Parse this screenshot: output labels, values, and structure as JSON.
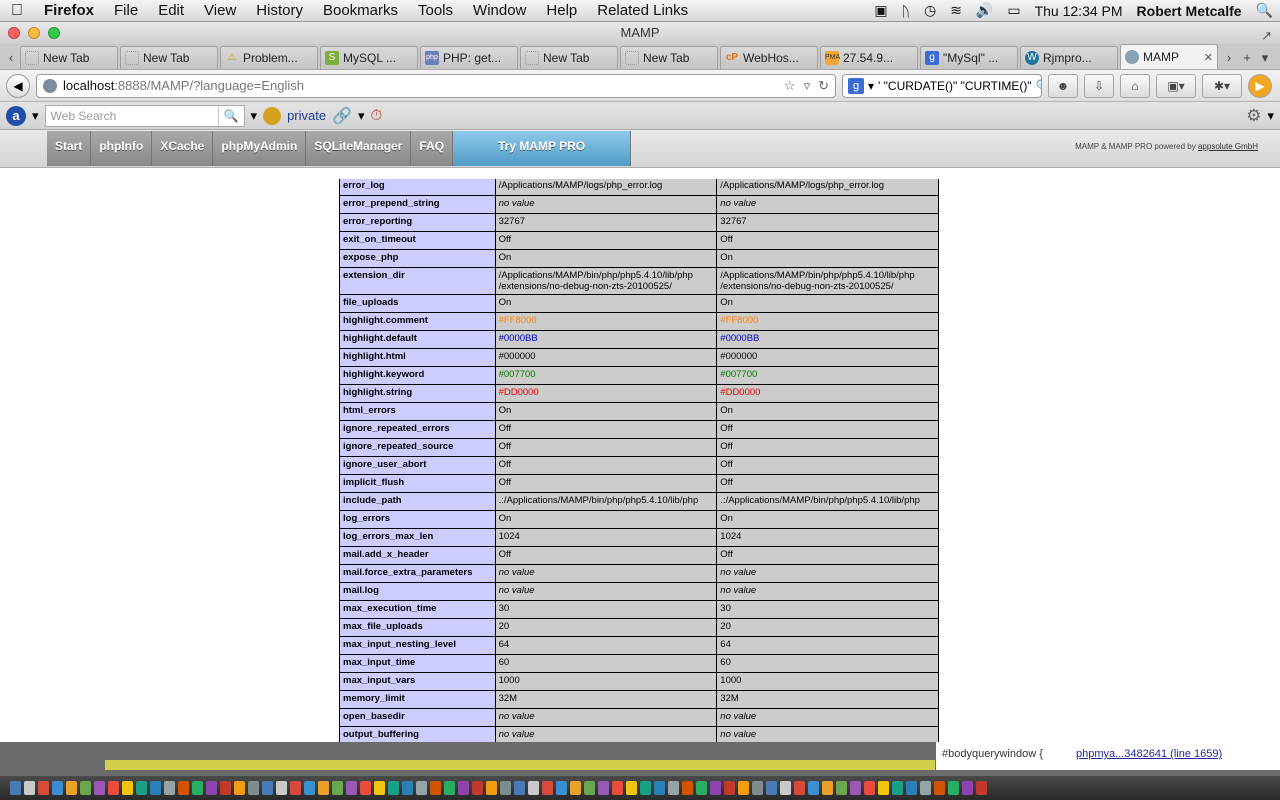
{
  "menubar": {
    "apple": "",
    "app": "Firefox",
    "items": [
      "File",
      "Edit",
      "View",
      "History",
      "Bookmarks",
      "Tools",
      "Window",
      "Help",
      "Related Links"
    ],
    "clock": "Thu 12:34 PM",
    "user": "Robert Metcalfe"
  },
  "window": {
    "title": "MAMP"
  },
  "tabs": [
    {
      "label": "New Tab",
      "icon": "blank-page-icon"
    },
    {
      "label": "New Tab",
      "icon": "blank-page-icon"
    },
    {
      "label": "Problem...",
      "icon": "warning-icon"
    },
    {
      "label": "MySQL ...",
      "icon": "mysql-icon"
    },
    {
      "label": "PHP: get...",
      "icon": "php-icon"
    },
    {
      "label": "New Tab",
      "icon": "blank-page-icon"
    },
    {
      "label": "New Tab",
      "icon": "blank-page-icon"
    },
    {
      "label": "WebHos...",
      "icon": "cpanel-icon"
    },
    {
      "label": "27.54.9...",
      "icon": "phpmyadmin-icon"
    },
    {
      "label": "\"MySql\" ...",
      "icon": "google-icon"
    },
    {
      "label": "Rjmpro...",
      "icon": "wordpress-icon"
    },
    {
      "label": "MAMP",
      "icon": "globe-icon",
      "active": true
    }
  ],
  "navbar": {
    "url_host": "localhost",
    "url_path": ":8888/MAMP/?language=English",
    "search_text": "' \"CURDATE()\" \"CURTIME()\""
  },
  "addonbar": {
    "search_placeholder": "Web Search",
    "private_label": "private"
  },
  "mamp": {
    "nav": [
      "Start",
      "phpInfo",
      "XCache",
      "phpMyAdmin",
      "SQLiteManager",
      "FAQ"
    ],
    "pro_button": "Try MAMP PRO",
    "powered_prefix": "MAMP & MAMP PRO powered by ",
    "powered_link": "appsolute GmbH"
  },
  "directives": [
    {
      "name": "error_log",
      "local": "/Applications/MAMP/logs/php_error.log",
      "master": "/Applications/MAMP/logs/php_error.log"
    },
    {
      "name": "error_prepend_string",
      "local": "no value",
      "master": "no value",
      "novalue": true
    },
    {
      "name": "error_reporting",
      "local": "32767",
      "master": "32767"
    },
    {
      "name": "exit_on_timeout",
      "local": "Off",
      "master": "Off"
    },
    {
      "name": "expose_php",
      "local": "On",
      "master": "On"
    },
    {
      "name": "extension_dir",
      "local": "/Applications/MAMP/bin/php/php5.4.10/lib/php /extensions/no-debug-non-zts-20100525/",
      "master": "/Applications/MAMP/bin/php/php5.4.10/lib/php /extensions/no-debug-non-zts-20100525/"
    },
    {
      "name": "file_uploads",
      "local": "On",
      "master": "On"
    },
    {
      "name": "highlight.comment",
      "local": "#FF8000",
      "master": "#FF8000",
      "color": "#FF8000"
    },
    {
      "name": "highlight.default",
      "local": "#0000BB",
      "master": "#0000BB",
      "color": "#0000BB"
    },
    {
      "name": "highlight.html",
      "local": "#000000",
      "master": "#000000"
    },
    {
      "name": "highlight.keyword",
      "local": "#007700",
      "master": "#007700",
      "color": "#007700"
    },
    {
      "name": "highlight.string",
      "local": "#DD0000",
      "master": "#DD0000",
      "color": "#DD0000"
    },
    {
      "name": "html_errors",
      "local": "On",
      "master": "On"
    },
    {
      "name": "ignore_repeated_errors",
      "local": "Off",
      "master": "Off"
    },
    {
      "name": "ignore_repeated_source",
      "local": "Off",
      "master": "Off"
    },
    {
      "name": "ignore_user_abort",
      "local": "Off",
      "master": "Off"
    },
    {
      "name": "implicit_flush",
      "local": "Off",
      "master": "Off"
    },
    {
      "name": "include_path",
      "local": ".:/Applications/MAMP/bin/php/php5.4.10/lib/php",
      "master": ".:/Applications/MAMP/bin/php/php5.4.10/lib/php"
    },
    {
      "name": "log_errors",
      "local": "On",
      "master": "On"
    },
    {
      "name": "log_errors_max_len",
      "local": "1024",
      "master": "1024"
    },
    {
      "name": "mail.add_x_header",
      "local": "Off",
      "master": "Off"
    },
    {
      "name": "mail.force_extra_parameters",
      "local": "no value",
      "master": "no value",
      "novalue": true
    },
    {
      "name": "mail.log",
      "local": "no value",
      "master": "no value",
      "novalue": true
    },
    {
      "name": "max_execution_time",
      "local": "30",
      "master": "30"
    },
    {
      "name": "max_file_uploads",
      "local": "20",
      "master": "20"
    },
    {
      "name": "max_input_nesting_level",
      "local": "64",
      "master": "64"
    },
    {
      "name": "max_input_time",
      "local": "60",
      "master": "60"
    },
    {
      "name": "max_input_vars",
      "local": "1000",
      "master": "1000"
    },
    {
      "name": "memory_limit",
      "local": "32M",
      "master": "32M"
    },
    {
      "name": "open_basedir",
      "local": "no value",
      "master": "no value",
      "novalue": true
    },
    {
      "name": "output_buffering",
      "local": "no value",
      "master": "no value",
      "novalue": true
    }
  ],
  "console": {
    "text": "#bodyquerywindow {",
    "link": "phpmya...3482641 (line 1659)"
  }
}
